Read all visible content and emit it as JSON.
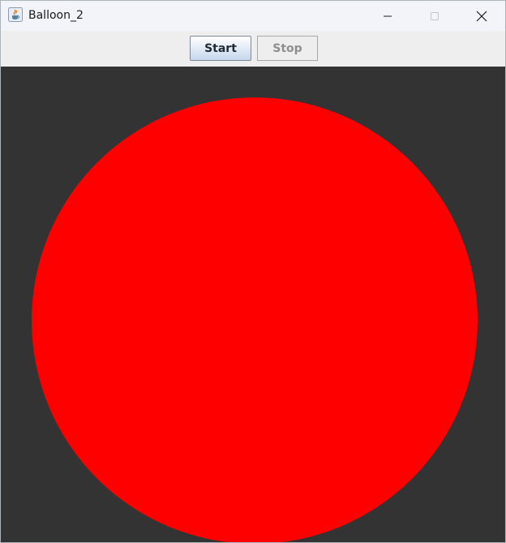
{
  "window": {
    "title": "Balloon_2",
    "icon": "java-coffee-cup-icon"
  },
  "toolbar": {
    "start_label": "Start",
    "stop_label": "Stop",
    "stop_enabled": false
  },
  "canvas": {
    "background_color": "#333333",
    "balloon_color": "#ff0000"
  }
}
